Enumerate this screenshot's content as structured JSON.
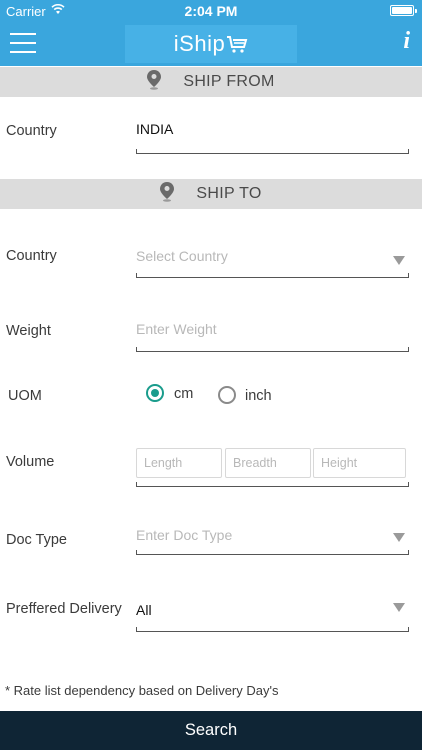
{
  "status_bar": {
    "carrier": "Carrier",
    "time": "2:04 PM"
  },
  "nav": {
    "logo_text": "iShip",
    "icons": [
      "menu-icon",
      "cart-icon",
      "info-icon"
    ],
    "info_glyph": "i"
  },
  "ship_from": {
    "title": "SHIP FROM",
    "country_label": "Country",
    "country_value": "INDIA"
  },
  "ship_to": {
    "title": "SHIP TO",
    "country_label": "Country",
    "country_placeholder": "Select Country",
    "weight_label": "Weight",
    "weight_placeholder": "Enter Weight",
    "uom_label": "UOM",
    "uom_options": [
      {
        "label": "cm",
        "selected": true
      },
      {
        "label": "inch",
        "selected": false
      }
    ],
    "volume_label": "Volume",
    "volume_placeholders": [
      "Length",
      "Breadth",
      "Height"
    ],
    "doc_type_label": "Doc Type",
    "doc_type_placeholder": "Enter Doc Type",
    "delivery_label": "Preffered Delivery",
    "delivery_value": "All"
  },
  "note": "* Rate list dependency based on Delivery Day's",
  "search_label": "Search",
  "colors": {
    "header_blue": "#3aa6dd",
    "section_gray": "#dcdcdc",
    "radio_teal": "#1a9c8c",
    "search_dark": "#0f2535"
  }
}
